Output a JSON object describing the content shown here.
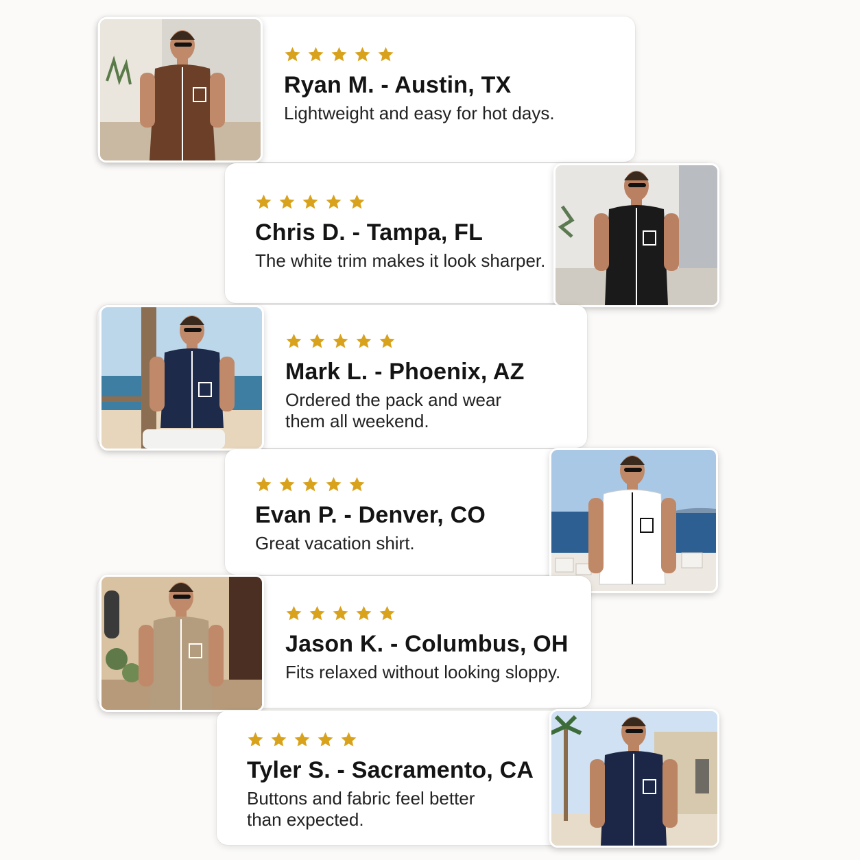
{
  "reviews": [
    {
      "rating": 5,
      "name": "Ryan M. - Austin, TX",
      "quote": "Lightweight and easy for hot days.",
      "shirt_color": "#6b3f28"
    },
    {
      "rating": 5,
      "name": "Chris D. - Tampa, FL",
      "quote": "The white trim makes it look sharper.",
      "shirt_color": "#1a1a1a"
    },
    {
      "rating": 5,
      "name": "Mark L. - Phoenix, AZ",
      "quote": "Ordered the pack and wear\nthem all weekend.",
      "shirt_color": "#1d2a4a"
    },
    {
      "rating": 5,
      "name": "Evan P. - Denver, CO",
      "quote": "Great vacation shirt.",
      "shirt_color": "#ffffff"
    },
    {
      "rating": 5,
      "name": "Jason K. - Columbus, OH",
      "quote": "Fits relaxed without looking sloppy.",
      "shirt_color": "#b49c7e"
    },
    {
      "rating": 5,
      "name": "Tyler S. - Sacramento, CA",
      "quote": "Buttons and fabric feel better\nthan expected.",
      "shirt_color": "#1c2747"
    }
  ],
  "colors": {
    "star": "#d9a21c",
    "text": "#141414",
    "background": "#fbfaf8"
  }
}
